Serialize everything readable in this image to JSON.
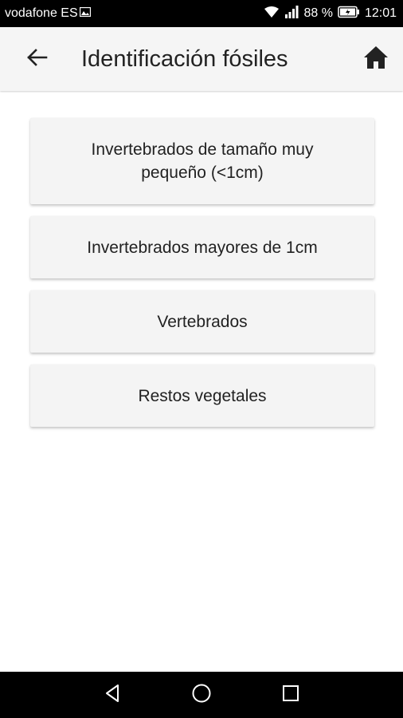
{
  "status_bar": {
    "carrier": "vodafone ES",
    "battery_percent": "88 %",
    "time": "12:01",
    "icons": [
      "image-notification-icon",
      "wifi-icon",
      "signal-icon",
      "battery-charging-icon"
    ]
  },
  "app_bar": {
    "title": "Identificación fósiles",
    "back_icon": "arrow-left-icon",
    "home_icon": "home-icon"
  },
  "menu": {
    "items": [
      {
        "label": "Invertebrados de tamaño muy pequeño (<1cm)"
      },
      {
        "label": "Invertebrados mayores de 1cm"
      },
      {
        "label": "Vertebrados"
      },
      {
        "label": "Restos vegetales"
      }
    ]
  },
  "nav_bar": {
    "icons": [
      "back-triangle-icon",
      "home-circle-icon",
      "recents-square-icon"
    ]
  },
  "colors": {
    "status_bar_bg": "#000000",
    "app_bar_bg": "#f5f5f5",
    "button_bg": "#f4f4f4",
    "text": "#222222",
    "nav_bar_bg": "#000000"
  }
}
